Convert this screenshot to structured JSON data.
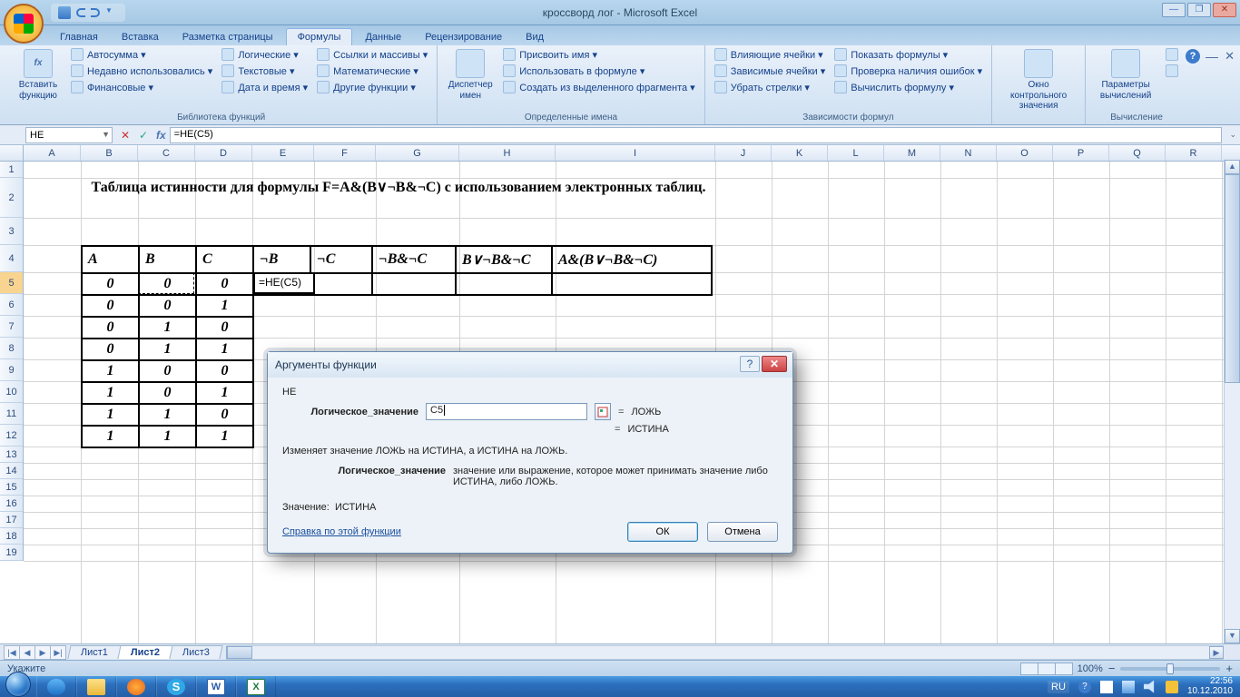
{
  "titlebar": {
    "title": "кроссворд лог - Microsoft Excel"
  },
  "tabs": [
    "Главная",
    "Вставка",
    "Разметка страницы",
    "Формулы",
    "Данные",
    "Рецензирование",
    "Вид"
  ],
  "active_tab": 3,
  "ribbon": {
    "g1": {
      "big": "Вставить функцию",
      "items": [
        "Автосумма",
        "Недавно использовались",
        "Финансовые",
        "Логические",
        "Текстовые",
        "Дата и время",
        "Ссылки и массивы",
        "Математические",
        "Другие функции"
      ],
      "label": "Библиотека функций"
    },
    "g2": {
      "big": "Диспетчер имен",
      "items": [
        "Присвоить имя",
        "Использовать в формуле",
        "Создать из выделенного фрагмента"
      ],
      "label": "Определенные имена"
    },
    "g3": {
      "items_l": [
        "Влияющие ячейки",
        "Зависимые ячейки",
        "Убрать стрелки"
      ],
      "items_r": [
        "Показать формулы",
        "Проверка наличия ошибок",
        "Вычислить формулу"
      ],
      "label": "Зависимости формул"
    },
    "g4": {
      "big": "Окно контрольного значения"
    },
    "g5": {
      "big": "Параметры вычислений",
      "label": "Вычисление"
    }
  },
  "namebox": "НЕ",
  "formula": "=НЕ(C5)",
  "columns": [
    "A",
    "B",
    "C",
    "D",
    "E",
    "F",
    "G",
    "H",
    "I",
    "J",
    "K",
    "L",
    "M",
    "N",
    "O",
    "P",
    "Q",
    "R"
  ],
  "title_text": "Таблица истинности для формулы F=A&(B∨¬B&¬C) с использованием электронных таблиц.",
  "headers": [
    "A",
    "B",
    "C",
    "¬B",
    "¬C",
    "¬B&¬C",
    "B∨¬B&¬C",
    "A&(B∨¬B&¬C)"
  ],
  "rows": [
    [
      "0",
      "0",
      "0"
    ],
    [
      "0",
      "0",
      "1"
    ],
    [
      "0",
      "1",
      "0"
    ],
    [
      "0",
      "1",
      "1"
    ],
    [
      "1",
      "0",
      "0"
    ],
    [
      "1",
      "0",
      "1"
    ],
    [
      "1",
      "1",
      "0"
    ],
    [
      "1",
      "1",
      "1"
    ]
  ],
  "active_cell_text": "=НЕ(C5)",
  "dialog": {
    "title": "Аргументы функции",
    "fn": "НЕ",
    "arg_label": "Логическое_значение",
    "arg_value": "C5",
    "arg_result": "ЛОЖЬ",
    "result": "ИСТИНА",
    "desc": "Изменяет значение ЛОЖЬ на ИСТИНА, а ИСТИНА на ЛОЖЬ.",
    "arg_desc_label": "Логическое_значение",
    "arg_desc": "значение или выражение, которое может принимать значение либо ИСТИНА, либо ЛОЖЬ.",
    "value_label": "Значение:",
    "value": "ИСТИНА",
    "help": "Справка по этой функции",
    "ok": "ОК",
    "cancel": "Отмена"
  },
  "sheets": [
    "Лист1",
    "Лист2",
    "Лист3"
  ],
  "active_sheet": 1,
  "status": "Укажите",
  "zoom": "100%",
  "tray": {
    "lang": "RU",
    "time": "22:56",
    "date": "10.12.2010"
  }
}
